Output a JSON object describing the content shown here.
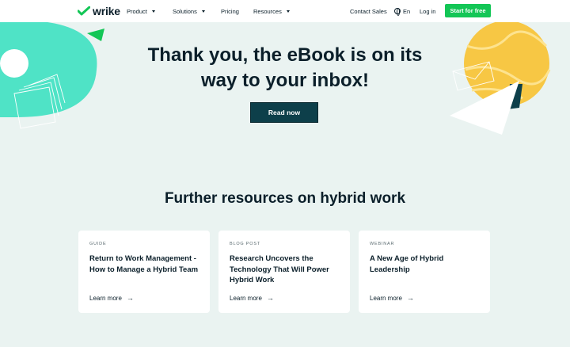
{
  "header": {
    "logo_text": "wrike",
    "nav": [
      {
        "label": "Product"
      },
      {
        "label": "Solutions"
      },
      {
        "label": "Pricing"
      },
      {
        "label": "Resources"
      }
    ],
    "contact_sales": "Contact Sales",
    "language": "En",
    "login": "Log in",
    "cta": "Start for free"
  },
  "hero": {
    "title_line1": "Thank you, the eBook is on its",
    "title_line2": "way to your inbox!",
    "button": "Read now"
  },
  "resources": {
    "title": "Further resources on hybrid work",
    "cards": [
      {
        "tag": "GUIDE",
        "title": "Return to Work Management - How to Manage a Hybrid Team",
        "link": "Learn more"
      },
      {
        "tag": "BLOG POST",
        "title": "Research Uncovers the Technology That Will Power Hybrid Work",
        "link": "Learn more"
      },
      {
        "tag": "WEBINAR",
        "title": "A New Age of Hybrid Leadership",
        "link": "Learn more"
      }
    ],
    "arrow": "→"
  },
  "colors": {
    "brand_green": "#13c656",
    "button_dark": "#0d3f4a",
    "background": "#eaf3f1",
    "teal_shape": "#4fe3c6",
    "yellow_shape": "#f7c744"
  }
}
